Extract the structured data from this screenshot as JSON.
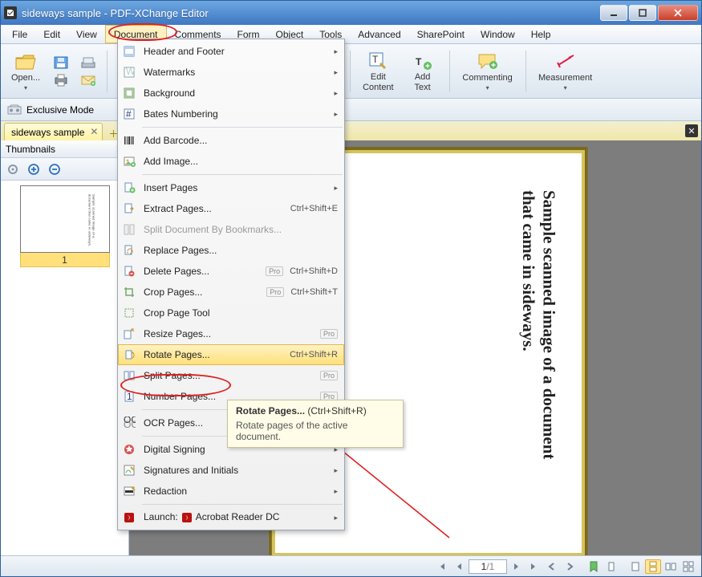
{
  "window": {
    "title": "sideways sample - PDF-XChange Editor"
  },
  "menubar": [
    "File",
    "Edit",
    "View",
    "Document",
    "Comments",
    "Form",
    "Object",
    "Tools",
    "Advanced",
    "SharePoint",
    "Window",
    "Help"
  ],
  "menubar_active_index": 3,
  "toolbar": {
    "open": "Open...",
    "edit_content": "Edit\nContent",
    "add_text": "Add\nText",
    "commenting": "Commenting",
    "measurement": "Measurement"
  },
  "exclusive_mode": "Exclusive Mode",
  "doc_tab": "sideways sample",
  "thumbnails": {
    "title": "Thumbnails",
    "page_number": "1"
  },
  "page_text": "Sample scanned image of a document\nthat came in sideways.",
  "dropdown": {
    "items": [
      {
        "icon": "header-footer",
        "label": "Header and Footer",
        "submenu": true
      },
      {
        "icon": "watermark",
        "label": "Watermarks",
        "submenu": true
      },
      {
        "icon": "background",
        "label": "Background",
        "submenu": true
      },
      {
        "icon": "bates",
        "label": "Bates Numbering",
        "submenu": true
      },
      {
        "sep": true
      },
      {
        "icon": "barcode",
        "label": "Add Barcode..."
      },
      {
        "icon": "image",
        "label": "Add Image..."
      },
      {
        "sep": true
      },
      {
        "icon": "insert",
        "label": "Insert Pages",
        "submenu": true
      },
      {
        "icon": "extract",
        "label": "Extract Pages...",
        "shortcut": "Ctrl+Shift+E"
      },
      {
        "icon": "split-bm",
        "label": "Split Document By Bookmarks...",
        "disabled": true
      },
      {
        "icon": "replace",
        "label": "Replace Pages..."
      },
      {
        "icon": "delete",
        "label": "Delete Pages...",
        "pro": true,
        "shortcut": "Ctrl+Shift+D"
      },
      {
        "icon": "crop",
        "label": "Crop Pages...",
        "pro": true,
        "shortcut": "Ctrl+Shift+T"
      },
      {
        "icon": "croptool",
        "label": "Crop Page Tool"
      },
      {
        "icon": "resize",
        "label": "Resize Pages...",
        "pro": true
      },
      {
        "icon": "rotate",
        "label": "Rotate Pages...",
        "shortcut": "Ctrl+Shift+R",
        "hover": true
      },
      {
        "icon": "split",
        "label": "Split Pages...",
        "pro": true
      },
      {
        "icon": "number",
        "label": "Number Pages...",
        "pro": true
      },
      {
        "sep": true
      },
      {
        "icon": "ocr",
        "label": "OCR Pages..."
      },
      {
        "sep": true
      },
      {
        "icon": "sign",
        "label": "Digital Signing",
        "submenu": true
      },
      {
        "icon": "initials",
        "label": "Signatures and Initials",
        "submenu": true
      },
      {
        "icon": "redact",
        "label": "Redaction",
        "submenu": true
      },
      {
        "sep": true
      },
      {
        "icon": "launch",
        "label_prefix": "Launch:",
        "label": "Acrobat Reader DC",
        "submenu": true
      }
    ]
  },
  "tooltip": {
    "title": "Rotate Pages...",
    "shortcut": "(Ctrl+Shift+R)",
    "body": "Rotate pages of the active document."
  },
  "status": {
    "page_current": "1",
    "page_sep": "/",
    "page_total": "1"
  }
}
